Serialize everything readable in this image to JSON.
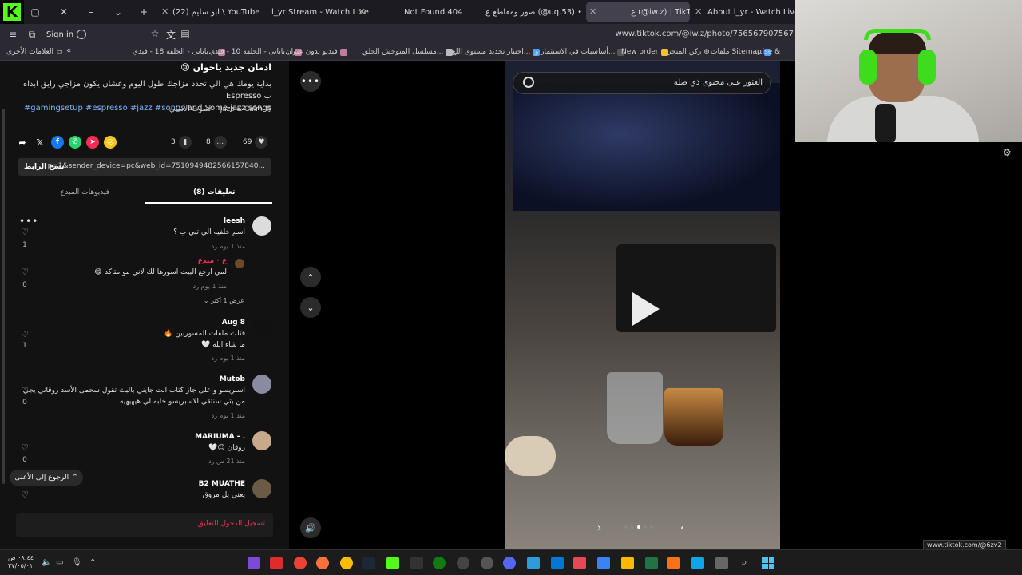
{
  "browser": {
    "tabs": [
      {
        "title": "ابو سليم (22) \\ YouTube - im",
        "badge_color": "#ff0000"
      },
      {
        "title": "l_yr Stream - Watch Live on",
        "badge_color": "#53fc18"
      },
      {
        "title": "Not Found 404",
        "badge_color": "#ff0000"
      },
      {
        "title": "صور ومقاطع ع (@uq.53) •",
        "badge_color": "#d62976"
      },
      {
        "title": "ع (@iw.z) | TikTok",
        "badge_color": "#ffffff",
        "active": true
      },
      {
        "title": "About l_yr - Watch Live on",
        "badge_color": "#53fc18"
      }
    ],
    "sign_in": "Sign in",
    "url": "www.tiktok.com/@iw.z/photo/756567907567"
  },
  "bookmarks": [
    {
      "label": "ملفات Sitemap",
      "color": "#4aa3ff"
    },
    {
      "label": "ركن المتجر",
      "color": "#6aa84f"
    },
    {
      "label": "New order",
      "color": "#f1c232"
    },
    {
      "label": "أساسيات في الاستثمار و...",
      "color": "#999999"
    },
    {
      "label": "اختبار تحديد مستوى اللغ...",
      "color": "#4aa3ff"
    },
    {
      "label": "مسلسل المتوحش الحلق...",
      "color": "#cccccc"
    },
    {
      "label": "فيديو بدون عنوان",
      "color": "#c27ba0"
    },
    {
      "label": "يابانى - الحلقة 10 - فيدي...",
      "color": "#cccccc"
    },
    {
      "label": "يابانى - الحلقة 18 - فيدي...",
      "color": "#cccccc"
    },
    {
      "label": "...ise &",
      "color": "#cccccc"
    },
    {
      "label": "العلامات الأخرى",
      "color": "#cccccc"
    }
  ],
  "post": {
    "title": "ادمان جديد ياخوان 😢",
    "desc_line1": "بداية يومك هي الي تحدد مزاجك طول اليوم وعشان يكون مزاجي رايق ابداه ب Espresso",
    "desc_line2_plain": "and Some jazz songs",
    "desc_line2_tags": "#gamingsetup #espresso #jazz #songs",
    "music": "الصوت الأسلي - Jazz & Calm",
    "likes": "69",
    "comments": "8",
    "saves": "3",
    "copy_label": "نسخ الرابط",
    "link_text": "p=1&sender_device=pc&web_id=7510949482566157840..."
  },
  "tabs": {
    "comments": "تعليقات (8)",
    "creator_videos": "فيديوهات المبدع"
  },
  "comments": [
    {
      "name": "leesh",
      "text": "اسم خلفيه الي تبي ب ؟",
      "meta": "منذ 1 يوم   رد",
      "likes": "1",
      "avatar": "#dcdcdc",
      "reply": {
        "name": "ع · مبدع",
        "text": "لمي ارجع البيت اسورها لك لاني مو متاكد 😂",
        "meta": "منذ 1 يوم   رد",
        "likes": "0"
      },
      "more": "عرض 1 أكثر"
    },
    {
      "name": "Aug 8",
      "text": "قتلت ملفات المسوربين 🔥",
      "text2": "ما شاء الله 🤍",
      "meta": "منذ 1 يوم   رد",
      "likes": "1",
      "avatar": "#111111"
    },
    {
      "name": "Mutob",
      "text": "اسبريسو واعلى جاز كتاب انت جايني بالبث تقول سحمى الأسد روقاني يجي",
      "text2": "من بتي سنتقي الاسبريسو خلبه لي هيهيهيه",
      "meta": "منذ 1 يوم   رد",
      "likes": "0",
      "avatar": "#8a8aa0"
    },
    {
      "name": "MARIUMA - .",
      "text": "روقان 😍🤍",
      "meta": "منذ 21 س   رد",
      "likes": "0",
      "avatar": "#c9a98c"
    },
    {
      "name": "B2 MUATHE",
      "text": "يعني يل مروق",
      "meta": "",
      "likes": "",
      "avatar": "#6b5a44"
    }
  ],
  "back_to_top": "الرجوع إلى الأعلى",
  "login_prompt": "تسجيل الدخول للتعليق",
  "video": {
    "search_placeholder": "العثور على محتوى ذي صلة",
    "slides_total": 5,
    "slide_current": 3
  },
  "status_url": "www.tiktok.com/@6zv2",
  "taskbar": {
    "time": "٠٨:٤٤ ص",
    "date": "٢٧/٠٥/٠١"
  }
}
